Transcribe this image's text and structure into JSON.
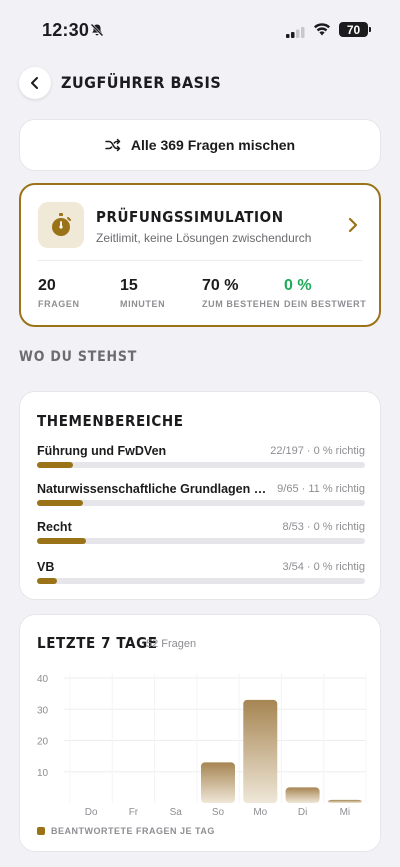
{
  "status_bar": {
    "time": "12:30",
    "battery": "70"
  },
  "header": {
    "title": "ZUGFÜHRER BASIS"
  },
  "shuffle": {
    "label": "Alle 369 Fragen mischen"
  },
  "exam": {
    "title": "PRÜFUNGSSIMULATION",
    "subtitle": "Zeitlimit, keine Lösungen zwischendurch",
    "stats": [
      {
        "value": "20",
        "label": "FRAGEN"
      },
      {
        "value": "15",
        "label": "MINUTEN"
      },
      {
        "value": "70 %",
        "label": "ZUM BESTEHEN"
      },
      {
        "value": "0 %",
        "label": "DEIN BESTWERT"
      }
    ]
  },
  "section_title": "WO DU STEHST",
  "topics": {
    "title": "THEMENBEREICHE",
    "items": [
      {
        "name": "Führung und FwDVen",
        "stat": "22/197 · 0 % richtig",
        "progress": 0.11
      },
      {
        "name": "Naturwissenschaftliche Grundlagen und Technik",
        "stat": "9/65 · 11 % richtig",
        "progress": 0.14
      },
      {
        "name": "Recht",
        "stat": "8/53 · 0 % richtig",
        "progress": 0.15
      },
      {
        "name": "VB",
        "stat": "3/54 · 0 % richtig",
        "progress": 0.06
      }
    ]
  },
  "colors": {
    "accent": "#9a7318",
    "green": "#1faa5a",
    "bar_top": "#a68552",
    "bar_bottom": "#efe7d8"
  },
  "chart_data": {
    "type": "bar",
    "title": "LETZTE 7 TAGE",
    "subtitle": "52 Fragen",
    "categories": [
      "Do",
      "Fr",
      "Sa",
      "So",
      "Mo",
      "Di",
      "Mi"
    ],
    "values": [
      0,
      0,
      0,
      13,
      33,
      5,
      1
    ],
    "ylim": [
      0,
      40
    ],
    "yticks": [
      10,
      20,
      30,
      40
    ],
    "grid": true,
    "legend": "BEANTWORTETE FRAGEN JE TAG"
  }
}
